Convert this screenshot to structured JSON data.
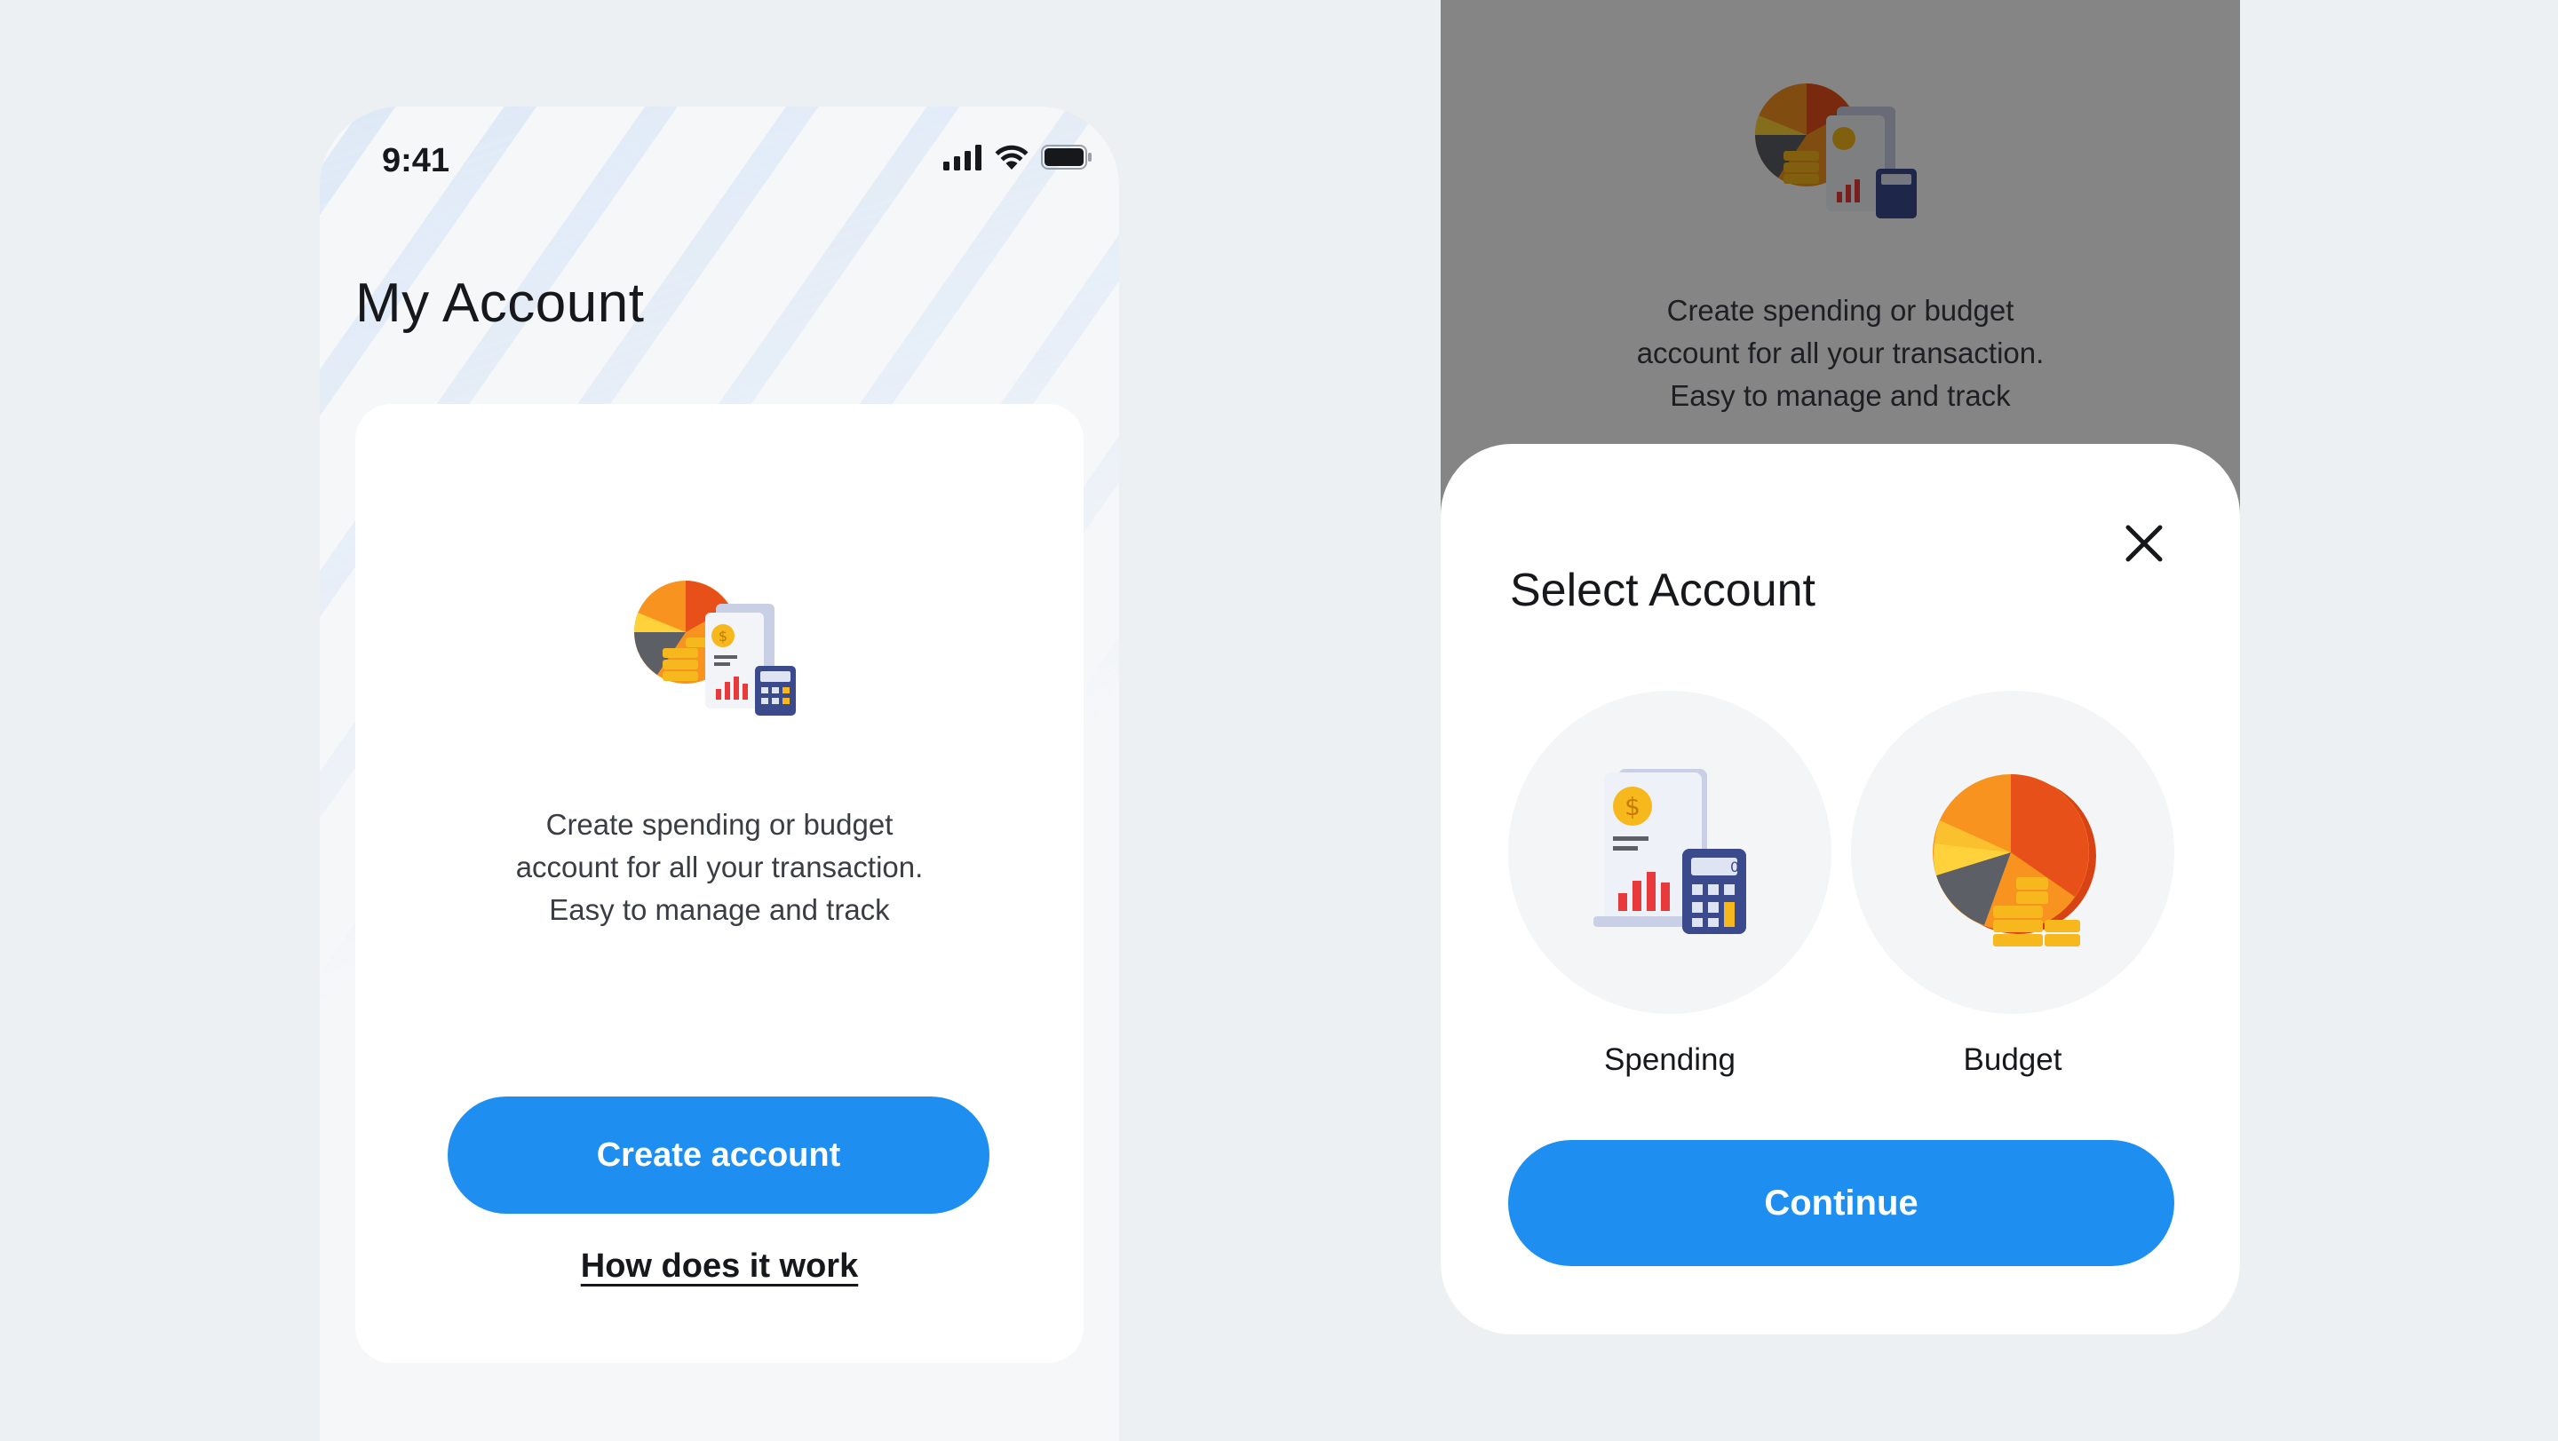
{
  "left_screen": {
    "status_bar": {
      "time": "9:41"
    },
    "title": "My Account",
    "card": {
      "description_lines": [
        "Create spending or budget",
        "account for all your transaction.",
        "Easy to manage and track"
      ],
      "create_button_label": "Create account",
      "how_link_label": "How does it work"
    }
  },
  "right_screen": {
    "background": {
      "description_lines": [
        "Create spending or budget",
        "account for all your transaction.",
        "Easy to manage and track"
      ]
    },
    "sheet": {
      "title": "Select Account",
      "options": [
        {
          "label": "Spending",
          "icon": "spending-report-icon"
        },
        {
          "label": "Budget",
          "icon": "budget-pie-icon"
        }
      ],
      "continue_label": "Continue"
    }
  },
  "colors": {
    "accent": "#1e8ff1",
    "page_background": "#edf0f3",
    "pie_orange": "#f7931e",
    "pie_red": "#e8501a",
    "coin_yellow": "#f6b81c",
    "calculator_navy": "#3b4a8c"
  }
}
